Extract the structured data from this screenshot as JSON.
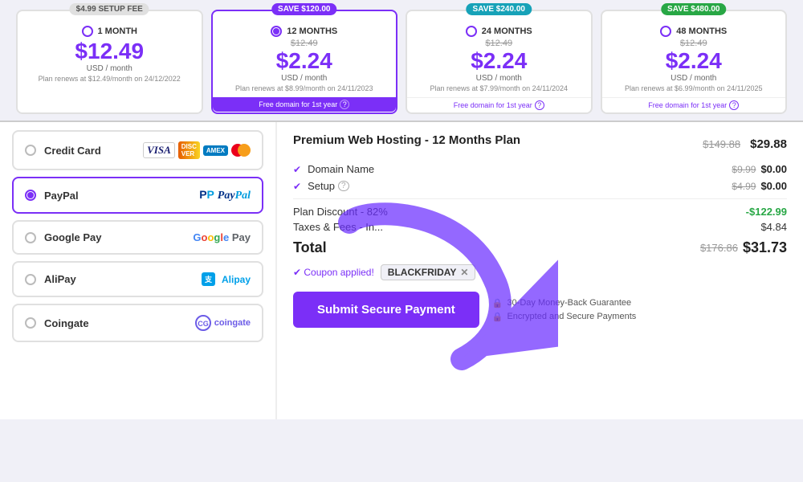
{
  "pricing": {
    "plans": [
      {
        "id": "1month",
        "badge": "$4.99 SETUP FEE",
        "badge_type": "gray",
        "duration": "1 MONTH",
        "old_price": null,
        "price": "$12.49",
        "period": "USD / month",
        "renew": "Plan renews at $12.49/month on 24/12/2022",
        "free_domain": false,
        "selected": false
      },
      {
        "id": "12months",
        "badge": "SAVE $120.00",
        "badge_type": "purple",
        "duration": "12 MONTHS",
        "old_price": "$12.49",
        "price": "$2.24",
        "period": "USD / month",
        "renew": "Plan renews at $8.99/month on 24/11/2023",
        "free_domain": true,
        "free_domain_text": "Free domain for 1st year",
        "selected": true
      },
      {
        "id": "24months",
        "badge": "SAVE $240.00",
        "badge_type": "blue",
        "duration": "24 MONTHS",
        "old_price": "$12.49",
        "price": "$2.24",
        "period": "USD / month",
        "renew": "Plan renews at $7.99/month on 24/11/2024",
        "free_domain": true,
        "free_domain_text": "Free domain for 1st year",
        "selected": false
      },
      {
        "id": "48months",
        "badge": "SAVE $480.00",
        "badge_type": "green",
        "duration": "48 MONTHS",
        "old_price": "$12.49",
        "price": "$2.24",
        "period": "USD / month",
        "renew": "Plan renews at $6.99/month on 24/11/2025",
        "free_domain": true,
        "free_domain_text": "Free domain for 1st year",
        "selected": false
      }
    ]
  },
  "payment": {
    "methods": [
      {
        "id": "credit_card",
        "label": "Credit Card",
        "selected": false
      },
      {
        "id": "paypal",
        "label": "PayPal",
        "selected": true
      },
      {
        "id": "google_pay",
        "label": "Google Pay",
        "selected": false
      },
      {
        "id": "alipay",
        "label": "AliPay",
        "selected": false
      },
      {
        "id": "coingate",
        "label": "Coingate",
        "selected": false
      }
    ]
  },
  "summary": {
    "title": "Premium Web Hosting - 12 Months Plan",
    "title_old_price": "$149.88",
    "title_new_price": "$29.88",
    "items": [
      {
        "label": "Domain Name",
        "old_price": "$9.99",
        "new_price": "$0.00",
        "has_info": false
      },
      {
        "label": "Setup",
        "old_price": "$4.99",
        "new_price": "$0.00",
        "has_info": true
      }
    ],
    "discount_label": "Plan Discount - 82%",
    "discount_value": "-$122.99",
    "taxes_label": "Taxes & Fees - In...",
    "taxes_value": "$4.84",
    "total_label": "Total",
    "total_old_price": "$176.86",
    "total_new_price": "$31.73",
    "coupon_applied_text": "✔ Coupon applied!",
    "coupon_code": "BLACKFRIDAY",
    "submit_label": "Submit Secure Payment",
    "guarantee1": "30-Day Money-Back Guarantee",
    "guarantee2": "Encrypted and Secure Payments"
  }
}
